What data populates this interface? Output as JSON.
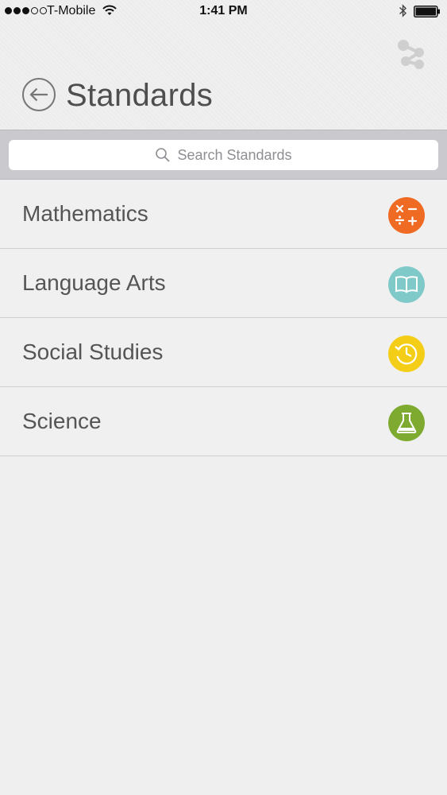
{
  "status_bar": {
    "carrier": "T-Mobile",
    "time": "1:41 PM",
    "signal_dots_filled": 3,
    "signal_dots_total": 5
  },
  "nav": {
    "title": "Standards",
    "back_icon": "back-arrow-icon",
    "share_icon": "share-icon"
  },
  "search": {
    "placeholder": "Search Standards"
  },
  "subjects": [
    {
      "label": "Mathematics",
      "icon": "math-operators-icon",
      "color": "#ef6a23"
    },
    {
      "label": "Language Arts",
      "icon": "open-book-icon",
      "color": "#7fc9c9"
    },
    {
      "label": "Social Studies",
      "icon": "history-clock-icon",
      "color": "#f4cd16"
    },
    {
      "label": "Science",
      "icon": "flask-icon",
      "color": "#7daa2f"
    }
  ]
}
